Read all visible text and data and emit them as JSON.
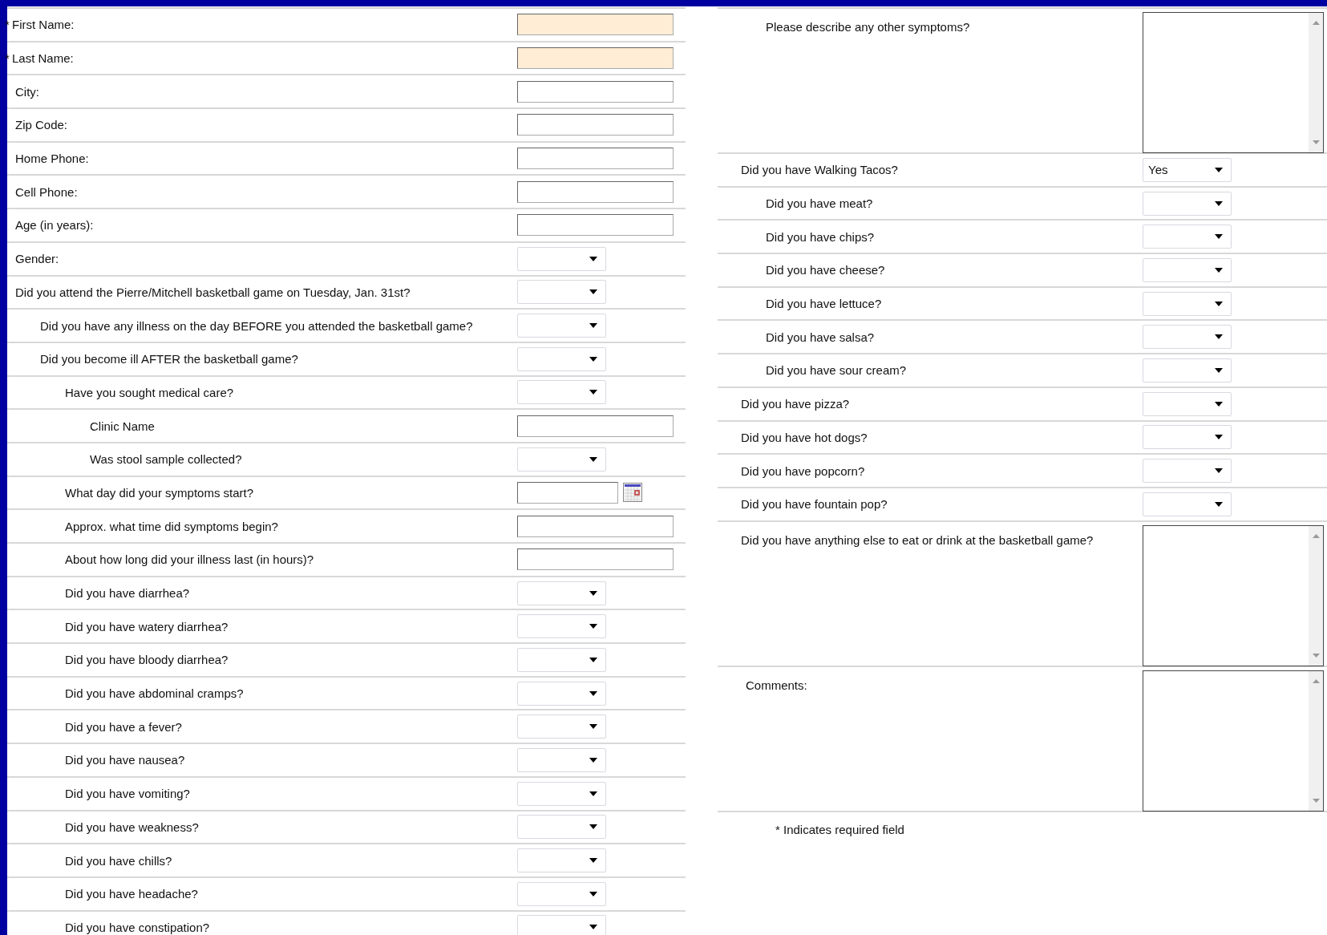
{
  "left": [
    {
      "kind": "text",
      "label": "First Name:",
      "marker": "*",
      "required": true
    },
    {
      "kind": "text",
      "label": "Last Name:",
      "marker": "*",
      "required": true
    },
    {
      "kind": "text",
      "label": "City:",
      "required": false
    },
    {
      "kind": "text",
      "label": "Zip Code:",
      "required": false
    },
    {
      "kind": "text",
      "label": "Home Phone:",
      "required": false
    },
    {
      "kind": "text",
      "label": "Cell Phone:",
      "required": false
    },
    {
      "kind": "text",
      "label": "Age (in years):",
      "required": false
    },
    {
      "kind": "select",
      "label": "Gender:"
    },
    {
      "kind": "select",
      "label": "Did you attend the Pierre/Mitchell basketball game on Tuesday, Jan. 31st?",
      "children": [
        {
          "kind": "select",
          "label": "Did you have any illness on the day BEFORE you attended the basketball game?"
        },
        {
          "kind": "select",
          "label": "Did you become ill AFTER the basketball game?",
          "children": [
            {
              "kind": "select",
              "label": "Have you sought medical care?",
              "children": [
                {
                  "kind": "text",
                  "label": "Clinic Name",
                  "required": false
                },
                {
                  "kind": "select",
                  "label": "Was stool sample collected?"
                }
              ]
            },
            {
              "kind": "date",
              "label": "What day did your symptoms start?"
            },
            {
              "kind": "text",
              "label": "Approx. what time did symptoms begin?",
              "required": false
            },
            {
              "kind": "text",
              "label": "About how long did your illness last (in hours)?",
              "required": false
            },
            {
              "kind": "select",
              "label": "Did you have diarrhea?"
            },
            {
              "kind": "select",
              "label": "Did you have watery diarrhea?"
            },
            {
              "kind": "select",
              "label": "Did you have bloody diarrhea?"
            },
            {
              "kind": "select",
              "label": "Did you have abdominal cramps?"
            },
            {
              "kind": "select",
              "label": "Did you have a fever?"
            },
            {
              "kind": "select",
              "label": "Did you have nausea?"
            },
            {
              "kind": "select",
              "label": "Did you have vomiting?"
            },
            {
              "kind": "select",
              "label": "Did you have weakness?"
            },
            {
              "kind": "select",
              "label": "Did you have chills?"
            },
            {
              "kind": "select",
              "label": "Did you have headache?"
            },
            {
              "kind": "select",
              "label": "Did you have constipation?"
            }
          ]
        }
      ]
    }
  ],
  "right_continued": [
    {
      "kind": "textarea",
      "label": "Please describe any other symptoms?"
    }
  ],
  "right": [
    {
      "kind": "select",
      "label": "Did you have Walking Tacos?",
      "value": "Yes",
      "children": [
        {
          "kind": "select",
          "label": "Did you have meat?"
        },
        {
          "kind": "select",
          "label": "Did you have chips?"
        },
        {
          "kind": "select",
          "label": "Did you have cheese?"
        },
        {
          "kind": "select",
          "label": "Did you have lettuce?"
        },
        {
          "kind": "select",
          "label": "Did you have salsa?"
        },
        {
          "kind": "select",
          "label": "Did you have sour cream?"
        }
      ]
    },
    {
      "kind": "select",
      "label": "Did you have pizza?"
    },
    {
      "kind": "select",
      "label": "Did you have hot dogs?"
    },
    {
      "kind": "select",
      "label": "Did you have popcorn?"
    },
    {
      "kind": "select",
      "label": "Did you have fountain pop?"
    },
    {
      "kind": "textarea",
      "label": "Did you have anything else to eat or drink at the basketball game?"
    }
  ],
  "comments": {
    "kind": "textarea",
    "label": "Comments:"
  },
  "note": "* Indicates required field"
}
